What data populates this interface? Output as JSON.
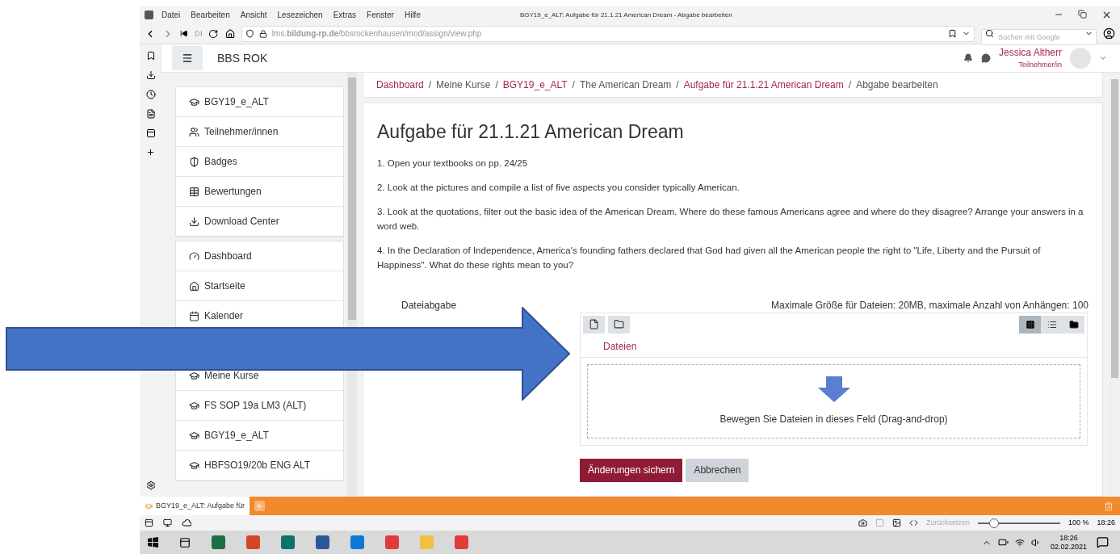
{
  "window": {
    "title": "BGY19_e_ALT: Aufgabe für 21.1.21 American Dream - Abgabe bearbeiten"
  },
  "menu": [
    "Datei",
    "Bearbeiten",
    "Ansicht",
    "Lesezeichen",
    "Extras",
    "Fenster",
    "Hilfe"
  ],
  "address_bar": {
    "url": "lms.**bildung-rp.de**/bbsrockenhausen/mod/assign/view.php"
  },
  "search": {
    "placeholder": "Suchen mit Google"
  },
  "site": {
    "name": "BBS ROK",
    "user_name": "Jessica Altherr",
    "user_role": "Teilnehmer/in"
  },
  "sidebar": {
    "groups": [
      {
        "items": [
          "BGY19_e_ALT",
          "Teilnehmer/innen",
          "Badges",
          "Bewertungen",
          "Download Center"
        ]
      },
      {
        "items": [
          "Dashboard",
          "Startseite",
          "Kalender",
          "Meine Kurse",
          "FS SOP 19a LM3 (ALT)",
          "BGY19_e_ALT",
          "HBFSO19/20b ENG ALT"
        ]
      }
    ]
  },
  "breadcrumb": [
    {
      "label": "Dashboard",
      "link": true
    },
    {
      "separator": "/",
      "label": "Meine Kurse",
      "link": false
    },
    {
      "separator": "/",
      "label": "BGY19_e_ALT",
      "link": true
    },
    {
      "separator": "/",
      "label": "The American Dream",
      "link": false
    },
    {
      "separator": "/",
      "label": "Aufgabe für 21.1.21 American Dream",
      "link": true
    },
    {
      "separator": "/",
      "label": "Abgabe bearbeiten",
      "link": false
    }
  ],
  "assignment": {
    "title": "Aufgabe für 21.1.21 American Dream",
    "paragraphs": [
      "1. Open your textbooks on pp. 24/25",
      "2. Look at the pictures and compile a list of five aspects you consider typically American.",
      "3. Look at the quotations, filter out the basic idea of the American Dream. Where do these famous Americans agree and where do they disagree? Arrange your answers in a word web.",
      "4. In the Declaration of Independence, America's founding fathers declared that God had given all the American people the right to \"Life, Liberty and the Pursuit of Happiness\". What do these rights mean to you?"
    ]
  },
  "file_submission": {
    "label": "Dateiabgabe",
    "limits": "Maximale Größe für Dateien: 20MB, maximale Anzahl von Anhängen: 100",
    "folder": "Dateien",
    "drop_hint": "Bewegen Sie Dateien in dieses Feld (Drag-and-drop)",
    "view_modes": [
      {
        "selected": true
      },
      {
        "selected": false
      },
      {
        "selected": false
      }
    ]
  },
  "buttons": [
    {
      "label": "Änderungen sichern",
      "kind": "primary"
    },
    {
      "label": "Abbrechen",
      "kind": "secondary"
    }
  ],
  "tabs": [
    {
      "label": "BGY19_e_ALT: Aufgabe für",
      "selected": true
    }
  ],
  "status_bar": {
    "reset": "Zurücksetzen",
    "zoom": {
      "level": 0.2
    },
    "zoom_reading": "100 %",
    "time": "18:26"
  },
  "taskbar": {
    "time": "18:26",
    "date": "02.02.2021"
  }
}
